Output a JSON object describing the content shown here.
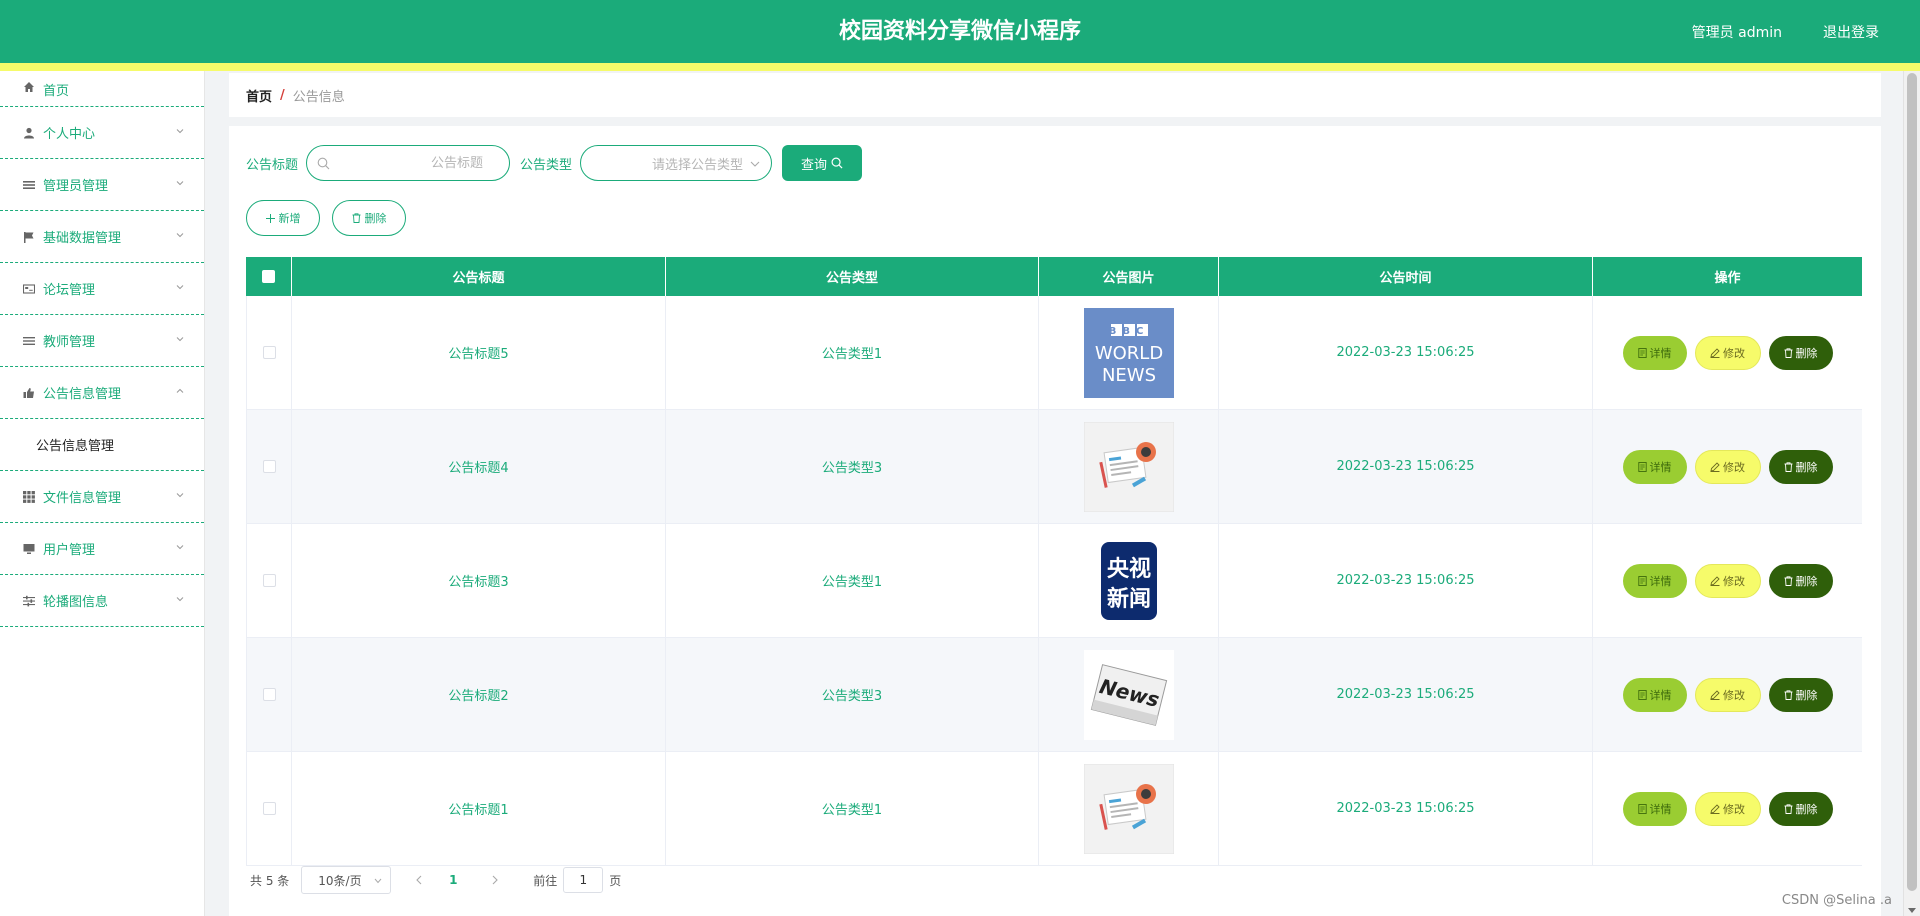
{
  "header": {
    "title": "校园资料分享微信小程序",
    "admin_label": "管理员 admin",
    "logout": "退出登录"
  },
  "sidebar": {
    "items": [
      {
        "label": "首页",
        "icon": "home-icon"
      },
      {
        "label": "个人中心",
        "icon": "user-icon"
      },
      {
        "label": "管理员管理",
        "icon": "list-icon"
      },
      {
        "label": "基础数据管理",
        "icon": "flag-icon"
      },
      {
        "label": "论坛管理",
        "icon": "card-icon"
      },
      {
        "label": "教师管理",
        "icon": "list-icon"
      },
      {
        "label": "公告信息管理",
        "icon": "thumb-icon"
      },
      {
        "label": "文件信息管理",
        "icon": "grid-icon"
      },
      {
        "label": "用户管理",
        "icon": "monitor-icon"
      },
      {
        "label": "轮播图信息",
        "icon": "sliders-icon"
      }
    ],
    "submenu_label": "公告信息管理"
  },
  "breadcrumb": {
    "home": "首页",
    "separator": "/",
    "current": "公告信息"
  },
  "search": {
    "title_label": "公告标题",
    "title_placeholder": "公告标题",
    "type_label": "公告类型",
    "type_placeholder": "请选择公告类型",
    "query_button": "查询"
  },
  "actions": {
    "add": "新增",
    "delete": "删除"
  },
  "table": {
    "columns": [
      "公告标题",
      "公告类型",
      "公告图片",
      "公告时间",
      "操作"
    ],
    "rows": [
      {
        "title": "公告标题5",
        "type": "公告类型1",
        "image": "bbc-world-news-image",
        "time": "2022-03-23 15:06:25"
      },
      {
        "title": "公告标题4",
        "type": "公告类型3",
        "image": "newspaper-illustration-image",
        "time": "2022-03-23 15:06:25"
      },
      {
        "title": "公告标题3",
        "type": "公告类型1",
        "image": "cctv-news-logo-image",
        "time": "2022-03-23 15:06:25"
      },
      {
        "title": "公告标题2",
        "type": "公告类型3",
        "image": "news-paper-image",
        "time": "2022-03-23 15:06:25"
      },
      {
        "title": "公告标题1",
        "type": "公告类型1",
        "image": "newspaper-illustration-image",
        "time": "2022-03-23 15:06:25"
      }
    ],
    "op_detail": "详情",
    "op_edit": "修改",
    "op_delete": "删除"
  },
  "logos": {
    "bbc": "BBC",
    "world": "WORLD",
    "news": "NEWS",
    "cctv_line1": "央视",
    "cctv_line2": "新闻",
    "news_paper": "News"
  },
  "pagination": {
    "total": "共 5 条",
    "page_size": "10条/页",
    "current_page": "1",
    "goto_label": "前往",
    "goto_value": "1",
    "page_suffix": "页"
  },
  "watermark": "CSDN @Selina .a",
  "colors": {
    "primary": "#1bab7a",
    "accent_yellow": "#f6fb6a",
    "detail_btn": "#9acd32",
    "delete_btn": "#2f5f0a"
  }
}
